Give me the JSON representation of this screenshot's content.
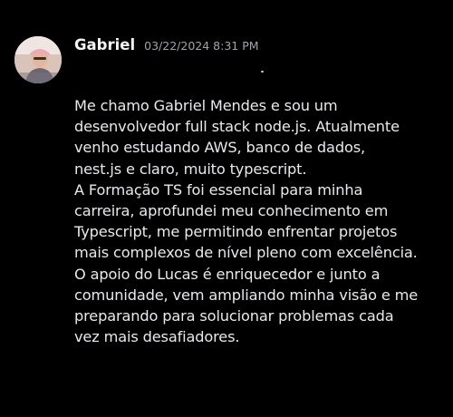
{
  "message": {
    "author": "Gabriel",
    "timestamp": "03/22/2024 8:31 PM",
    "avatar_icon": "user-avatar",
    "lines": [
      "Me chamo Gabriel Mendes e sou um",
      "desenvolvedor full stack node.js. Atualmente",
      "venho estudando AWS, banco de dados,",
      "nest.js e claro, muito typescript.",
      "A Formação TS foi essencial para minha",
      "carreira, aprofundei meu conhecimento em",
      "Typescript, me permitindo enfrentar projetos",
      "mais complexos de nível pleno com excelência.",
      "O apoio do Lucas é enriquecedor e junto a",
      "comunidade, vem ampliando minha visão e me",
      "preparando para solucionar problemas cada",
      "vez mais desafiadores."
    ]
  }
}
